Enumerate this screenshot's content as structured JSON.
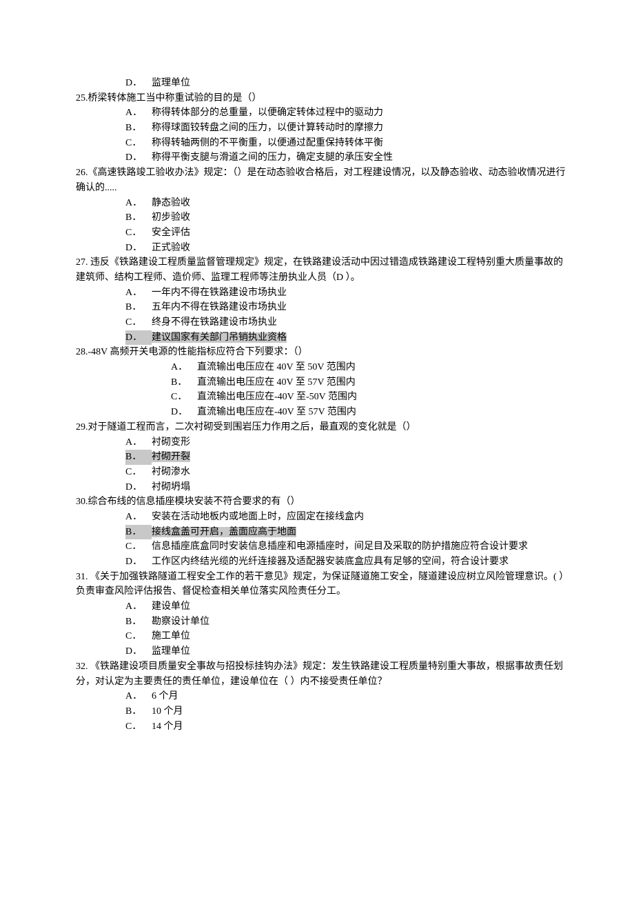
{
  "orphanOption": {
    "letter": "D．",
    "text": "监理单位"
  },
  "questions": [
    {
      "stem": "25.桥梁转体施工当中称重试验的目的是（）",
      "optionIndent": "indent1",
      "options": [
        {
          "letter": "A．",
          "text": "称得转体部分的总重量，以便确定转体过程中的驱动力"
        },
        {
          "letter": "B．",
          "text": "称得球面铰转盘之间的压力，以便计算转动时的摩擦力"
        },
        {
          "letter": "C．",
          "text": "称得转轴两侧的不平衡重，以便通过配重保持转体平衡"
        },
        {
          "letter": "D．",
          "text": "称得平衡支腿与滑道之间的压力，确定支腿的承压安全性"
        }
      ]
    },
    {
      "stem": "26.《高速铁路竣工验收办法》规定：（）是在动态验收合格后，对工程建设情况，以及静态验收、动态验收情况进行确认的.....",
      "optionIndent": "indent1",
      "options": [
        {
          "letter": "A．",
          "text": "静态验收"
        },
        {
          "letter": "B．",
          "text": "初步验收"
        },
        {
          "letter": "C．",
          "text": "安全评估"
        },
        {
          "letter": "D．",
          "text": "正式验收"
        }
      ]
    },
    {
      "stem": "27.  违反《铁路建设工程质量监督管理规定》规定，在铁路建设活动中因过错造成铁路建设工程特别重大质量事故的建筑师、结构工程师、造价师、监理工程师等注册执业人员（D  ）。",
      "optionIndent": "indent1",
      "options": [
        {
          "letter": "A．",
          "text": "一年内不得在铁路建设市场执业"
        },
        {
          "letter": "B．",
          "text": "五年内不得在铁路建设市场执业"
        },
        {
          "letter": "C．",
          "text": "终身不得在铁路建设市场执业"
        },
        {
          "letter": "D．",
          "text": "建议国家有关部门吊销执业资格",
          "highlight": true
        }
      ]
    },
    {
      "stem": "28.-48V 高频开关电源的性能指标应符合下列要求：（）",
      "optionIndent": "indent2",
      "options": [
        {
          "letter": "A．",
          "text": "直流输出电压应在 40V 至 50V 范围内"
        },
        {
          "letter": "B．",
          "text": "直流输出电压应在 40V 至 57V 范围内"
        },
        {
          "letter": "C．",
          "text": "直流输出电压应在-40V 至-50V 范围内"
        },
        {
          "letter": "D．",
          "text": "直流输出电压应在-40V 至 57V 范围内"
        }
      ]
    },
    {
      "stem": "29.对于隧道工程而言，二次衬砌受到围岩压力作用之后，最直观的变化就是（）",
      "optionIndent": "indent1",
      "options": [
        {
          "letter": "A．",
          "text": "衬砌变形"
        },
        {
          "letter": "B．",
          "text": "衬砌开裂",
          "highlight": true
        },
        {
          "letter": "C．",
          "text": "衬砌渗水"
        },
        {
          "letter": "D．",
          "text": "衬砌坍塌"
        }
      ]
    },
    {
      "stem": "30.综合布线的信息插座模块安装不符合要求的有（）",
      "optionIndent": "indent1",
      "options": [
        {
          "letter": "A．",
          "text": "安装在活动地板内或地面上时，应固定在接线盒内"
        },
        {
          "letter": "B．",
          "text": "接线盒盖可开启，盖面应高于地面",
          "highlight": true
        },
        {
          "letter": "C．",
          "text": "信息插座底盒同时安装信息插座和电源插座时，间足目及采取的防护措施应符合设计要求"
        },
        {
          "letter": "D．",
          "text": "工作区内终结光缆的光纤连接器及适配器安装底盒应具有足够的空间，符合设计要求"
        }
      ]
    },
    {
      "stem": "31.  《关于加强铁路隧道工程安全工作的若干意见》规定，为保证隧道施工安全，隧道建设应树立风险管理意识。(   ）负责审查风险评估报告、督促检查相关单位落实风险责任分工。",
      "optionIndent": "indent1",
      "options": [
        {
          "letter": "A．",
          "text": "建设单位"
        },
        {
          "letter": "B．",
          "text": "勘察设计单位"
        },
        {
          "letter": "C．",
          "text": "施工单位"
        },
        {
          "letter": "D．",
          "text": "监理单位"
        }
      ]
    },
    {
      "stem": "32. 《铁路建设项目质量安全事故与招投标挂钩办法》规定：发生铁路建设工程质量特别重大事故，根据事故责任划分，对认定为主要责任的责任单位，建设单位在（  ）内不接受责任单位？",
      "optionIndent": "indent1",
      "options": [
        {
          "letter": "A．",
          "text": "6 个月"
        },
        {
          "letter": "B．",
          "text": "10 个月"
        },
        {
          "letter": "C．",
          "text": "14 个月"
        }
      ]
    }
  ]
}
